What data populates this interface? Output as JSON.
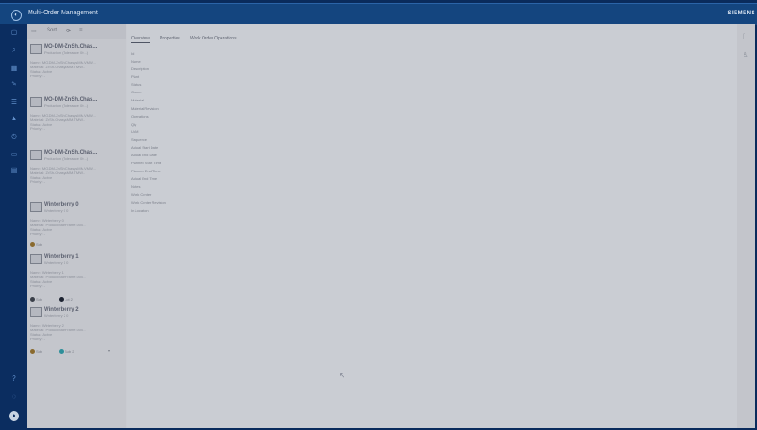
{
  "app": {
    "title": "Multi-Order Management",
    "brand": "SIEMENS"
  },
  "list": {
    "toolbar": [
      "▭",
      "Sort",
      "⟳",
      "≡"
    ],
    "cards": [
      {
        "name": "MO-DM-ZnSh.Chas...",
        "sub": "Production (Tolerance 00...)",
        "lines": [
          "Name: MO-DM-ZnSh.ChasysMM.VMW...",
          "Material: ZnSh-ChasysMM.TMW...",
          "Status: Active",
          "Priority: -"
        ],
        "chips": []
      },
      {
        "name": "MO-DM-ZnSh.Chas...",
        "sub": "Production (Tolerance 00...)",
        "lines": [
          "Name: MO-DM-ZnSh.ChasysMM.VMW...",
          "Material: ZnSh-ChasysMM.TMW...",
          "Status: Active",
          "Priority: -"
        ],
        "chips": []
      },
      {
        "name": "MO-DM-ZnSh.Chas...",
        "sub": "Production (Tolerance 00...)",
        "lines": [
          "Name: MO-DM-ZnSh.ChasysMM.VMW...",
          "Material: ZnSh-ChasysMM.TMW...",
          "Status: Active",
          "Priority: -"
        ],
        "chips": []
      },
      {
        "name": "Winterberry 0",
        "sub": "Winterberry 0 0",
        "lines": [
          "Name: Winterberry 0",
          "Material: ProductMainFrame.000...",
          "Status: Active",
          "Priority: -"
        ],
        "chips": [
          {
            "label": "Sub",
            "color": "#8a6a2e"
          }
        ]
      },
      {
        "name": "Winterberry 1",
        "sub": "Winterberry 1 0",
        "lines": [
          "Name: Winterberry 1",
          "Material: ProductMainFrame.000...",
          "Status: Active",
          "Priority: -"
        ],
        "chips": [
          {
            "label": "Sub",
            "color": "#3a3f49"
          },
          {
            "label": "Lot 2",
            "color": "#1c2230"
          }
        ]
      },
      {
        "name": "Winterberry 2",
        "sub": "Winterberry 2 0",
        "lines": [
          "Name: Winterberry 2",
          "Material: ProductMainFrame.000...",
          "Status: Active",
          "Priority: -"
        ],
        "chips": [
          {
            "label": "Sub",
            "color": "#8a6a2e"
          },
          {
            "label": "Sub 2",
            "color": "#2e8f9a"
          }
        ]
      }
    ]
  },
  "tabs": [
    "Overview",
    "Properties",
    "Work Order Operations"
  ],
  "fields": [
    "Id",
    "Name",
    "Description",
    "Plant",
    "Status",
    "Owner",
    "Material",
    "Material Revision",
    "Operations",
    "Qty",
    "UoM",
    "Sequence",
    "Actual Start Date",
    "Actual End Date",
    "Planned Start Time",
    "Planned End Time",
    "Actual End Time",
    "Notes",
    "Work Center",
    "Work Center Revision",
    "In Location"
  ],
  "rail_icons": [
    "home-icon",
    "search-icon",
    "grid-icon",
    "wrench-icon",
    "list-icon",
    "user-icon",
    "clock-icon",
    "folder-icon",
    "settings-icon"
  ],
  "colors": {
    "accent": "#14457f",
    "rail": "#0b2d60",
    "panel": "#c9cbd1"
  }
}
